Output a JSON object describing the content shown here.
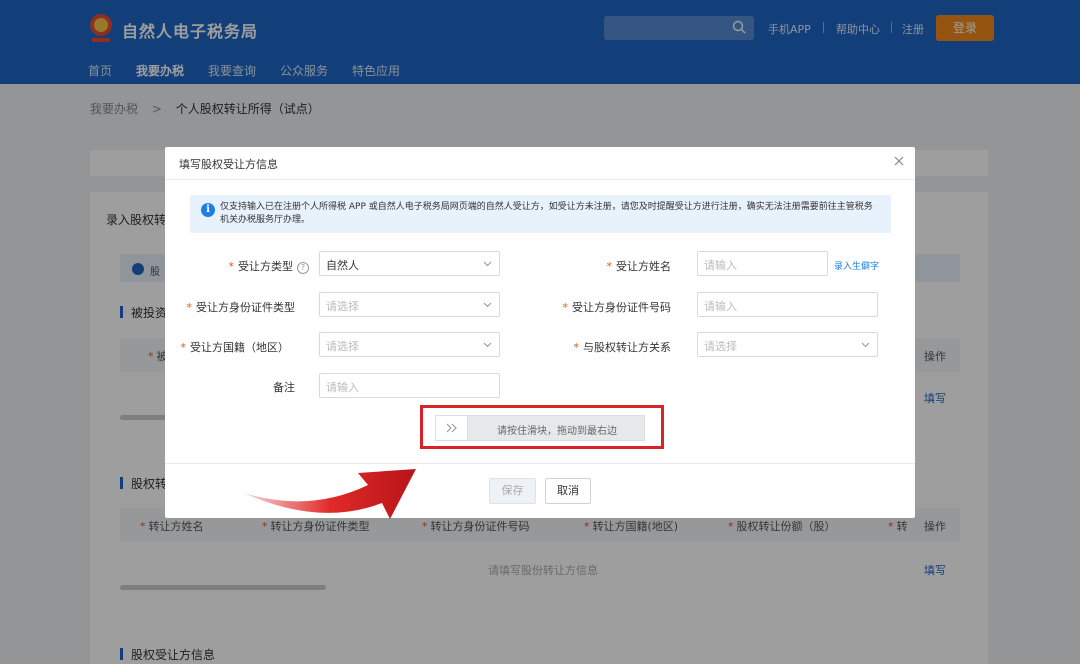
{
  "header": {
    "site_title": "自然人电子税务局",
    "links": [
      "手机APP",
      "帮助中心",
      "注册"
    ],
    "login": "登录",
    "nav": [
      "首页",
      "我要办税",
      "我要查询",
      "公众服务",
      "特色应用"
    ]
  },
  "breadcrumb": {
    "parent": "我要办税",
    "separator": ">",
    "current": "个人股权转让所得（试点）"
  },
  "background": {
    "section1_label": "录入股权转",
    "info_badge": "股",
    "section2_label": "被投资",
    "col_partial": "被",
    "op_header": "操作",
    "fill_link": "填写",
    "section3_label": "股权转",
    "table2_headers": [
      "转让方姓名",
      "转让方身份证件类型",
      "转让方身份证件号码",
      "转让方国籍(地区)",
      "股权转让份额（股）",
      "转"
    ],
    "table2_empty": "请填写股份转让方信息",
    "section4_label": "股权受让方信息"
  },
  "modal": {
    "title": "填写股权受让方信息",
    "notice": "仅支持输入已在注册个人所得税 APP 或自然人电子税务局网页端的自然人受让方，如受让方未注册，请您及时提醒受让方进行注册，确实无法注册需要前往主管税务机关办税服务厅办理。",
    "fields": {
      "transferee_type": {
        "label": "受让方类型",
        "value": "自然人",
        "help": "?"
      },
      "transferee_name": {
        "label": "受让方姓名",
        "placeholder": "请输入",
        "link": "录入生僻字"
      },
      "id_type": {
        "label": "受让方身份证件类型",
        "placeholder": "请选择"
      },
      "id_number": {
        "label": "受让方身份证件号码",
        "placeholder": "请输入"
      },
      "nationality": {
        "label": "受让方国籍（地区）",
        "placeholder": "请选择"
      },
      "relation": {
        "label": "与股权转让方关系",
        "placeholder": "请选择"
      },
      "remark": {
        "label": "备注",
        "placeholder": "请输入"
      }
    },
    "slider_text": "请按住滑块，拖动到最右边",
    "save": "保存",
    "cancel": "取消"
  },
  "colors": {
    "brand": "#1e66c3",
    "login": "#f08a1a",
    "required": "#e6561f",
    "highlight": "#d8232a"
  }
}
